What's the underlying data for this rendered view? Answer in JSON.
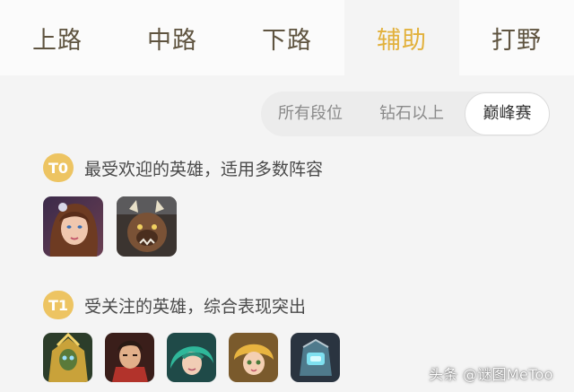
{
  "tabs": [
    {
      "label": "上路",
      "active": false
    },
    {
      "label": "中路",
      "active": false
    },
    {
      "label": "下路",
      "active": false
    },
    {
      "label": "辅助",
      "active": true
    },
    {
      "label": "打野",
      "active": false
    }
  ],
  "rank_filter": {
    "options": [
      "所有段位",
      "钻石以上",
      "巅峰赛"
    ],
    "selected": "巅峰赛"
  },
  "tiers": [
    {
      "badge": "T0",
      "description": "最受欢迎的英雄，适用多数阵容",
      "hero_count": 2
    },
    {
      "badge": "T1",
      "description": "受关注的英雄，综合表现突出",
      "hero_count": 5
    }
  ],
  "colors": {
    "accent": "#e2b13c",
    "badge": "#edc462",
    "tab_text": "#5f5440",
    "background": "#f4f4f4"
  },
  "watermark": "头条 @谜图MeToo"
}
